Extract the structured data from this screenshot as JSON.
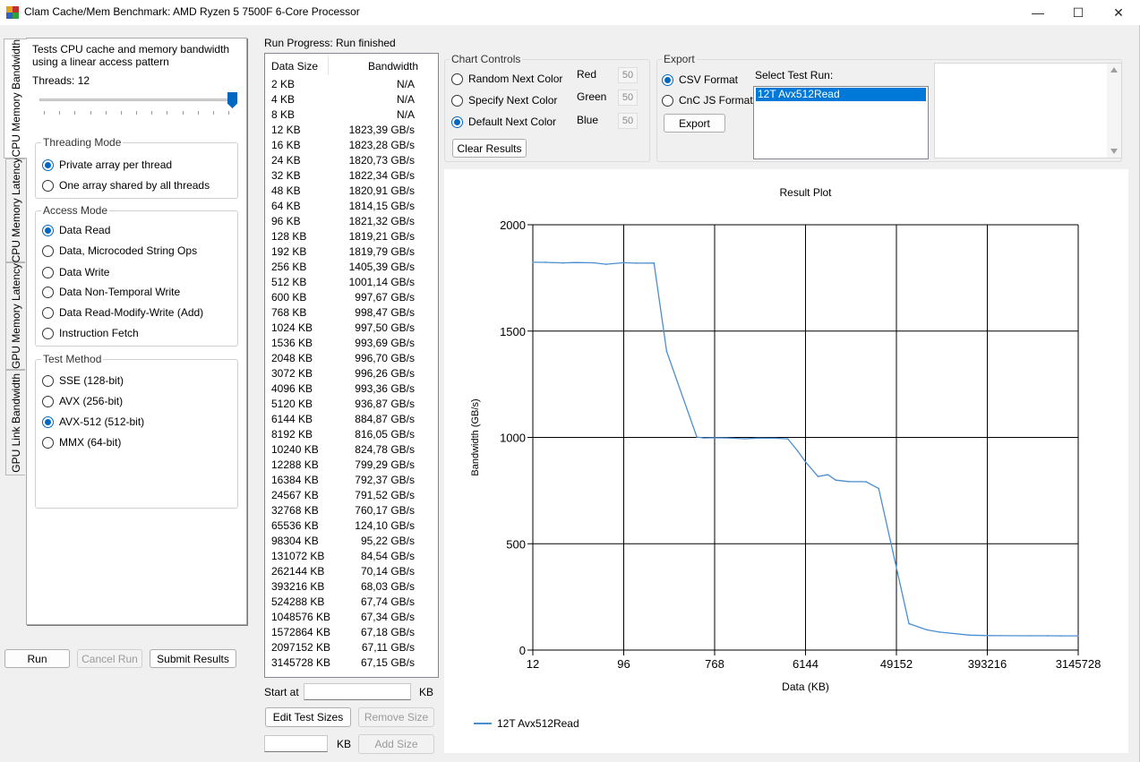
{
  "window": {
    "title": "Clam Cache/Mem Benchmark: AMD Ryzen 5 7500F 6-Core Processor",
    "minimize": "—",
    "maximize": "☐",
    "close": "✕"
  },
  "tabs": [
    "CPU Memory Bandwidth",
    "CPU Memory Latency",
    "GPU Memory Latency",
    "GPU Link Bandwidth"
  ],
  "left": {
    "description": "Tests CPU cache and memory bandwidth using a linear access pattern",
    "threads_label": "Threads: 12",
    "threads_value": 12,
    "threading_mode": {
      "title": "Threading Mode",
      "options": [
        "Private array per thread",
        "One array shared by all threads"
      ],
      "selected": 0
    },
    "access_mode": {
      "title": "Access Mode",
      "options": [
        "Data Read",
        "Data, Microcoded String Ops",
        "Data Write",
        "Data Non-Temporal Write",
        "Data Read-Modify-Write (Add)",
        "Instruction Fetch"
      ],
      "selected": 0
    },
    "test_method": {
      "title": "Test Method",
      "options": [
        "SSE (128-bit)",
        "AVX (256-bit)",
        "AVX-512 (512-bit)",
        "MMX (64-bit)"
      ],
      "selected": 2
    }
  },
  "buttons": {
    "run": "Run",
    "cancel": "Cancel Run",
    "submit": "Submit Results"
  },
  "progress": {
    "label": "Run Progress:",
    "value": "Run finished"
  },
  "results": {
    "headers": [
      "Data Size",
      "Bandwidth"
    ],
    "rows": [
      [
        "2 KB",
        "N/A"
      ],
      [
        "4 KB",
        "N/A"
      ],
      [
        "8 KB",
        "N/A"
      ],
      [
        "12 KB",
        "1823,39 GB/s"
      ],
      [
        "16 KB",
        "1823,28 GB/s"
      ],
      [
        "24 KB",
        "1820,73 GB/s"
      ],
      [
        "32 KB",
        "1822,34 GB/s"
      ],
      [
        "48 KB",
        "1820,91 GB/s"
      ],
      [
        "64 KB",
        "1814,15 GB/s"
      ],
      [
        "96 KB",
        "1821,32 GB/s"
      ],
      [
        "128 KB",
        "1819,21 GB/s"
      ],
      [
        "192 KB",
        "1819,79 GB/s"
      ],
      [
        "256 KB",
        "1405,39 GB/s"
      ],
      [
        "512 KB",
        "1001,14 GB/s"
      ],
      [
        "600 KB",
        "997,67 GB/s"
      ],
      [
        "768 KB",
        "998,47 GB/s"
      ],
      [
        "1024 KB",
        "997,50 GB/s"
      ],
      [
        "1536 KB",
        "993,69 GB/s"
      ],
      [
        "2048 KB",
        "996,70 GB/s"
      ],
      [
        "3072 KB",
        "996,26 GB/s"
      ],
      [
        "4096 KB",
        "993,36 GB/s"
      ],
      [
        "5120 KB",
        "936,87 GB/s"
      ],
      [
        "6144 KB",
        "884,87 GB/s"
      ],
      [
        "8192 KB",
        "816,05 GB/s"
      ],
      [
        "10240 KB",
        "824,78 GB/s"
      ],
      [
        "12288 KB",
        "799,29 GB/s"
      ],
      [
        "16384 KB",
        "792,37 GB/s"
      ],
      [
        "24567 KB",
        "791,52 GB/s"
      ],
      [
        "32768 KB",
        "760,17 GB/s"
      ],
      [
        "65536 KB",
        "124,10 GB/s"
      ],
      [
        "98304 KB",
        "95,22 GB/s"
      ],
      [
        "131072 KB",
        "84,54 GB/s"
      ],
      [
        "262144 KB",
        "70,14 GB/s"
      ],
      [
        "393216 KB",
        "68,03 GB/s"
      ],
      [
        "524288 KB",
        "67,74 GB/s"
      ],
      [
        "1048576 KB",
        "67,34 GB/s"
      ],
      [
        "1572864 KB",
        "67,18 GB/s"
      ],
      [
        "2097152 KB",
        "67,11 GB/s"
      ],
      [
        "3145728 KB",
        "67,15 GB/s"
      ]
    ]
  },
  "sizes": {
    "start_at": "Start at",
    "unit": "KB",
    "edit": "Edit Test Sizes",
    "remove": "Remove Size",
    "add": "Add Size"
  },
  "chart_controls": {
    "title": "Chart Controls",
    "options": [
      "Random Next Color",
      "Specify Next Color",
      "Default Next Color"
    ],
    "selected": 2,
    "red_label": "Red",
    "green_label": "Green",
    "blue_label": "Blue",
    "red": "50",
    "green": "50",
    "blue": "50",
    "clear": "Clear Results"
  },
  "export": {
    "title": "Export",
    "options": [
      "CSV Format",
      "CnC JS Format"
    ],
    "selected": 0,
    "button": "Export",
    "select_label": "Select Test Run:",
    "runs": [
      "12T Avx512Read"
    ]
  },
  "accent_color": "#0067c0",
  "series_color": "#4b8ed0",
  "chart_data": {
    "type": "line",
    "title": "Result Plot",
    "xlabel": "Data (KB)",
    "ylabel": "Bandwidth (GB/s)",
    "x_scale": "log",
    "ylim": [
      0,
      2000
    ],
    "yticks": [
      0,
      500,
      1000,
      1500,
      2000
    ],
    "xticks": [
      12,
      96,
      768,
      6144,
      49152,
      393216,
      3145728
    ],
    "grid": true,
    "legend": "bottom-left",
    "series": [
      {
        "name": "12T Avx512Read",
        "x": [
          12,
          16,
          24,
          32,
          48,
          64,
          96,
          128,
          192,
          256,
          512,
          600,
          768,
          1024,
          1536,
          2048,
          3072,
          4096,
          5120,
          6144,
          8192,
          10240,
          12288,
          16384,
          24567,
          32768,
          65536,
          98304,
          131072,
          262144,
          393216,
          524288,
          1048576,
          1572864,
          2097152,
          3145728
        ],
        "y": [
          1823.39,
          1823.28,
          1820.73,
          1822.34,
          1820.91,
          1814.15,
          1821.32,
          1819.21,
          1819.79,
          1405.39,
          1001.14,
          997.67,
          998.47,
          997.5,
          993.69,
          996.7,
          996.26,
          993.36,
          936.87,
          884.87,
          816.05,
          824.78,
          799.29,
          792.37,
          791.52,
          760.17,
          124.1,
          95.22,
          84.54,
          70.14,
          68.03,
          67.74,
          67.34,
          67.18,
          67.11,
          67.15
        ]
      }
    ]
  }
}
